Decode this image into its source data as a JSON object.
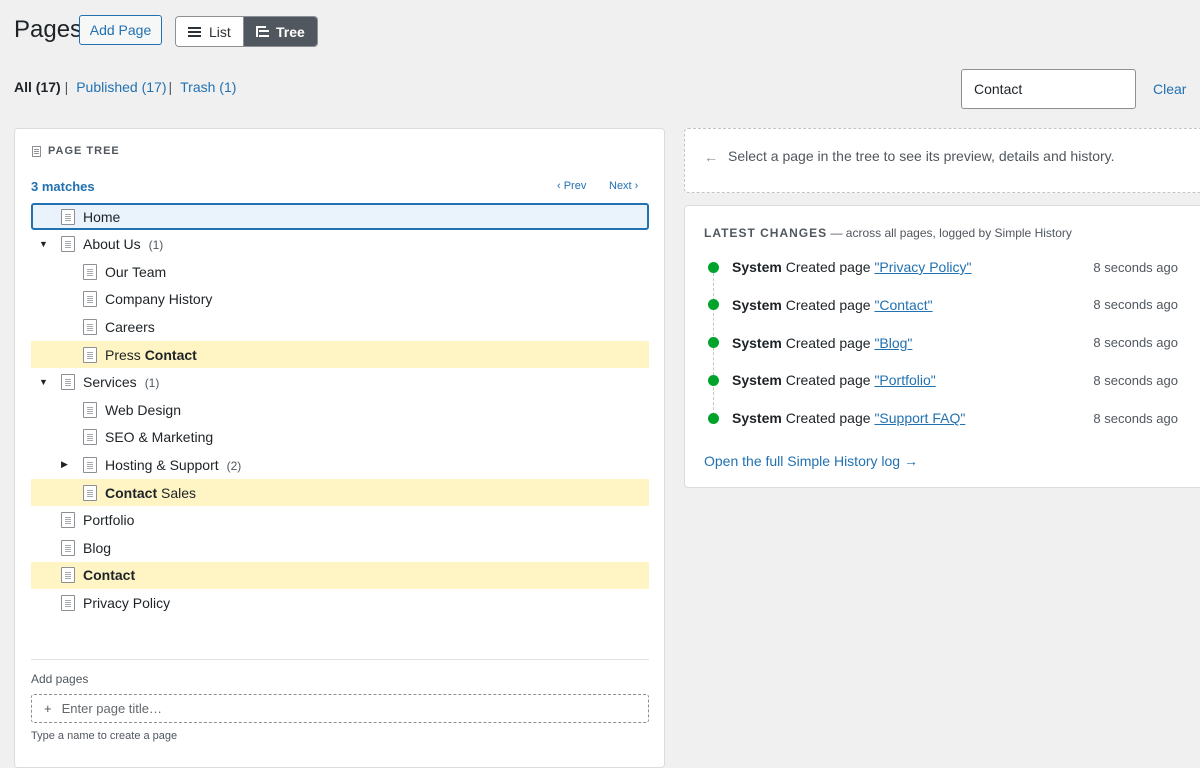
{
  "header": {
    "title": "Pages",
    "add_page": "Add Page",
    "view_list": "List",
    "view_tree": "Tree"
  },
  "filters": {
    "all": "All (17)",
    "published": "Published (17)",
    "trash": "Trash (1)"
  },
  "search": {
    "value": "Contact",
    "clear": "Clear"
  },
  "tree": {
    "heading": "PAGE TREE",
    "matches": "3 matches",
    "prev": "‹ Prev",
    "next": "Next ›",
    "rows": [
      {
        "label": "Home",
        "state": "selected"
      },
      {
        "label": "About Us",
        "count": "(1)",
        "toggle": "expanded"
      },
      {
        "label": "Our Team"
      },
      {
        "label": "Company History"
      },
      {
        "label": "Careers"
      },
      {
        "pre": "Press ",
        "match": "Contact",
        "state": "highlight"
      },
      {
        "label": "Services",
        "count": "(1)",
        "toggle": "expanded"
      },
      {
        "label": "Web Design"
      },
      {
        "label": "SEO & Marketing"
      },
      {
        "label": "Hosting & Support",
        "count": "(2)",
        "toggle": "collapsed"
      },
      {
        "match": "Contact",
        "post": " Sales",
        "state": "highlight"
      },
      {
        "label": "Portfolio"
      },
      {
        "label": "Blog"
      },
      {
        "match": "Contact",
        "state": "highlight"
      },
      {
        "label": "Privacy Policy"
      }
    ],
    "add_label": "Add pages",
    "add_placeholder": "Enter page title…",
    "add_hint": "Type a name to create a page"
  },
  "hint": {
    "text": "Select a page in the tree to see its preview, details and history."
  },
  "changes": {
    "heading": "LATEST CHANGES",
    "subheading": " — across all pages, logged by Simple History",
    "items": [
      {
        "user": "System",
        "action": "Created page",
        "page": "\"Privacy Policy\"",
        "time": "8 seconds ago"
      },
      {
        "user": "System",
        "action": "Created page",
        "page": "\"Contact\"",
        "time": "8 seconds ago"
      },
      {
        "user": "System",
        "action": "Created page",
        "page": "\"Blog\"",
        "time": "8 seconds ago"
      },
      {
        "user": "System",
        "action": "Created page",
        "page": "\"Portfolio\"",
        "time": "8 seconds ago"
      },
      {
        "user": "System",
        "action": "Created page",
        "page": "\"Support FAQ\"",
        "time": "8 seconds ago"
      }
    ],
    "open_log": "Open the full Simple History log →"
  },
  "colors": {
    "accent": "#2271b1",
    "highlight": "#fff4c4",
    "status_dot": "#00a32a"
  }
}
